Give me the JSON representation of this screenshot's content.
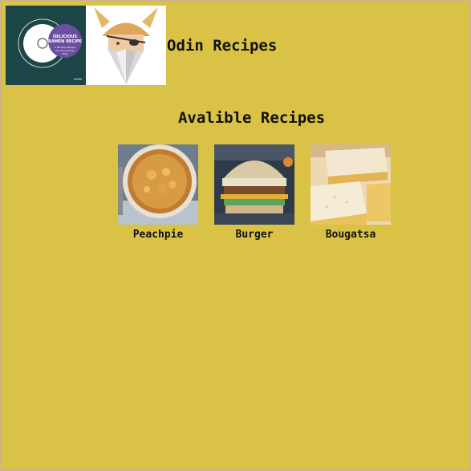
{
  "header": {
    "site_title": "Odin Recipes",
    "thumbnail": {
      "title_line1": "DELICIOUS",
      "title_line2": "RAMEN RECIPE",
      "subtitle_line1": "A Must-Try Recipe",
      "subtitle_line2": "for the Cooking",
      "subtitle_line3": "Blog"
    }
  },
  "main": {
    "section_title": "Avalible Recipes",
    "recipes": [
      {
        "label": "Peachpie"
      },
      {
        "label": "Burger"
      },
      {
        "label": "Bougatsa"
      }
    ]
  },
  "colors": {
    "background": "#d9c245",
    "thumb_teal": "#1d4b4d",
    "thumb_purple": "#6a4fa0"
  }
}
